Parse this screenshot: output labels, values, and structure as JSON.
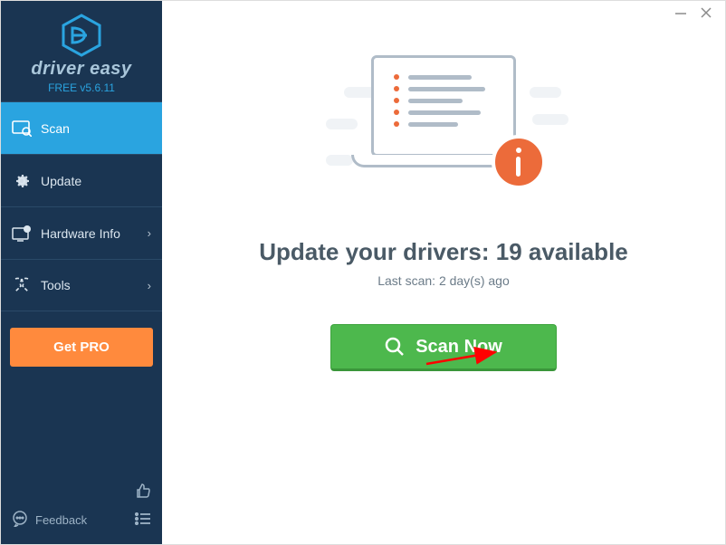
{
  "brand": {
    "name": "driver easy",
    "version": "FREE v5.6.11"
  },
  "nav": {
    "scan": "Scan",
    "update": "Update",
    "hardware": "Hardware Info",
    "tools": "Tools"
  },
  "get_pro": "Get PRO",
  "feedback": "Feedback",
  "main": {
    "headline_prefix": "Update your drivers: ",
    "available_count": "19",
    "headline_suffix": " available",
    "last_scan": "Last scan: 2 day(s) ago",
    "scan_button": "Scan Now"
  },
  "icons": {
    "scan": "scan-icon",
    "update": "gear-icon",
    "hardware": "computer-info-icon",
    "tools": "tools-icon",
    "feedback": "chat-icon",
    "thumbs": "thumbs-up-icon",
    "list": "list-icon",
    "magnify": "magnify-icon",
    "info": "info-icon"
  }
}
